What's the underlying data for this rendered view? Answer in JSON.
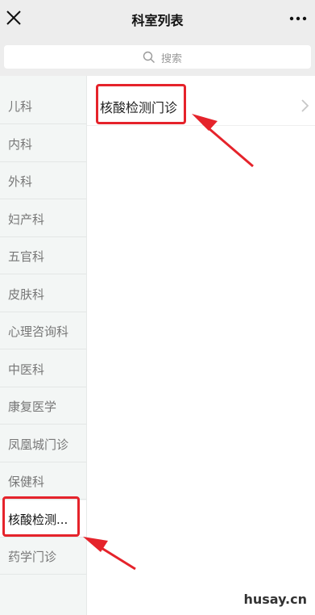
{
  "header": {
    "title": "科室列表"
  },
  "search": {
    "placeholder": "搜索"
  },
  "sidebar": {
    "items": [
      {
        "label": "儿科"
      },
      {
        "label": "内科"
      },
      {
        "label": "外科"
      },
      {
        "label": "妇产科"
      },
      {
        "label": "五官科"
      },
      {
        "label": "皮肤科"
      },
      {
        "label": "心理咨询科"
      },
      {
        "label": "中医科"
      },
      {
        "label": "康复医学"
      },
      {
        "label": "凤凰城门诊"
      },
      {
        "label": "保健科"
      },
      {
        "label": "核酸检测..."
      },
      {
        "label": "药学门诊"
      }
    ],
    "active_index": 11
  },
  "content": {
    "items": [
      {
        "label": "核酸检测门诊"
      }
    ]
  },
  "watermark": {
    "text": "husay.cn"
  },
  "colors": {
    "highlight": "#e5232b",
    "header_bg": "#ededed",
    "sidebar_bg": "#f3f6f5"
  },
  "icons": [
    "close-icon",
    "more-icon",
    "search-icon",
    "chevron-right-icon"
  ]
}
